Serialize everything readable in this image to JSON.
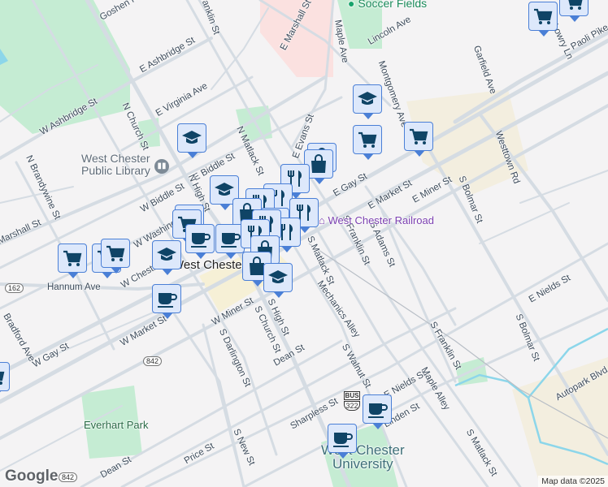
{
  "map": {
    "street_labels": [
      "Goshen Rd",
      "N Franklin St",
      "E Marshall St",
      "Maple Ave",
      "Lincoln Ave",
      "Montgomery Ave",
      "Garfield Ave",
      "Paoli Pike",
      "E Ashbridge St",
      "W Ashbridge St",
      "E Virginia Ave",
      "N Church St",
      "N Matlack St",
      "E Evans St",
      "N Brandywine St",
      "E Biddle St",
      "W Biddle St",
      "N High St",
      "W Washington St",
      "Marshall St",
      "W Chestnut St",
      "Hannum Ave",
      "E Gay St",
      "E Market St",
      "E Miner St",
      "S Bolmar St",
      "Westtown Rd",
      "W Market St",
      "W Miner St",
      "S High St",
      "S Matlack St",
      "S Franklin St",
      "S Adams St",
      "Mechanics Alley",
      "E Nields St",
      "E Nields St",
      "S Church St",
      "W Gay St",
      "S Darlington St",
      "Dean St",
      "S Walnut St",
      "S Franklin St",
      "Maple Alley",
      "Sharpless St",
      "Linden St",
      "Price St",
      "S New St",
      "Dean St",
      "S Matlack St",
      "S Bolmar St",
      "Autopark Blvd",
      "Bradford Ave",
      "N Lowry Ln"
    ],
    "poi_labels": {
      "soccer": "Soccer Fields",
      "library": "West Chester Public Library",
      "railroad": "West Chester Railroad",
      "town": "West Chester",
      "park": "Everhart Park",
      "university_line1": "West Chester",
      "university_line2": "University"
    },
    "route_shields": {
      "bus": "BUS",
      "us322": "322",
      "r842a": "842",
      "r842b": "842",
      "r162": "162"
    },
    "markers": [
      {
        "type": "cart",
        "label": "Grocery store"
      },
      {
        "type": "cart",
        "label": "Grocery store"
      },
      {
        "type": "cap",
        "label": "School"
      },
      {
        "type": "cart",
        "label": "Grocery store"
      },
      {
        "type": "cart",
        "label": "Grocery store"
      },
      {
        "type": "cap",
        "label": "School"
      },
      {
        "type": "cap",
        "label": "School"
      },
      {
        "type": "bag",
        "label": "Shop"
      },
      {
        "type": "bag",
        "label": "Shop"
      },
      {
        "type": "fork",
        "label": "Restaurant"
      },
      {
        "type": "fork",
        "label": "Restaurant"
      },
      {
        "type": "fork",
        "label": "Restaurant"
      },
      {
        "type": "fork",
        "label": "Restaurant"
      },
      {
        "type": "bag",
        "label": "Shop"
      },
      {
        "type": "fork",
        "label": "Restaurant"
      },
      {
        "type": "fork",
        "label": "Restaurant"
      },
      {
        "type": "cart",
        "label": "Grocery store"
      },
      {
        "type": "cart",
        "label": "Grocery store"
      },
      {
        "type": "cup",
        "label": "Cafe"
      },
      {
        "type": "cup",
        "label": "Cafe"
      },
      {
        "type": "fork",
        "label": "Restaurant"
      },
      {
        "type": "fork",
        "label": "Restaurant"
      },
      {
        "type": "cart",
        "label": "Grocery store"
      },
      {
        "type": "cart",
        "label": "Grocery store"
      },
      {
        "type": "cart",
        "label": "Grocery store"
      },
      {
        "type": "cap",
        "label": "School"
      },
      {
        "type": "bag",
        "label": "Shop"
      },
      {
        "type": "bag",
        "label": "Shop"
      },
      {
        "type": "cap",
        "label": "School"
      },
      {
        "type": "cup",
        "label": "Cafe"
      },
      {
        "type": "cup",
        "label": "Cafe"
      },
      {
        "type": "cup",
        "label": "Cafe"
      },
      {
        "type": "cart",
        "label": "Grocery store"
      }
    ],
    "colors": {
      "marker_fill": "#dde8fb",
      "marker_border": "#4a7fd6",
      "icon": "#0f4466",
      "park": "#c5ecd3",
      "road": "#d5dce3",
      "water": "#8cd6ea"
    },
    "attribution": "Map data ©2025",
    "logo": "Google"
  }
}
